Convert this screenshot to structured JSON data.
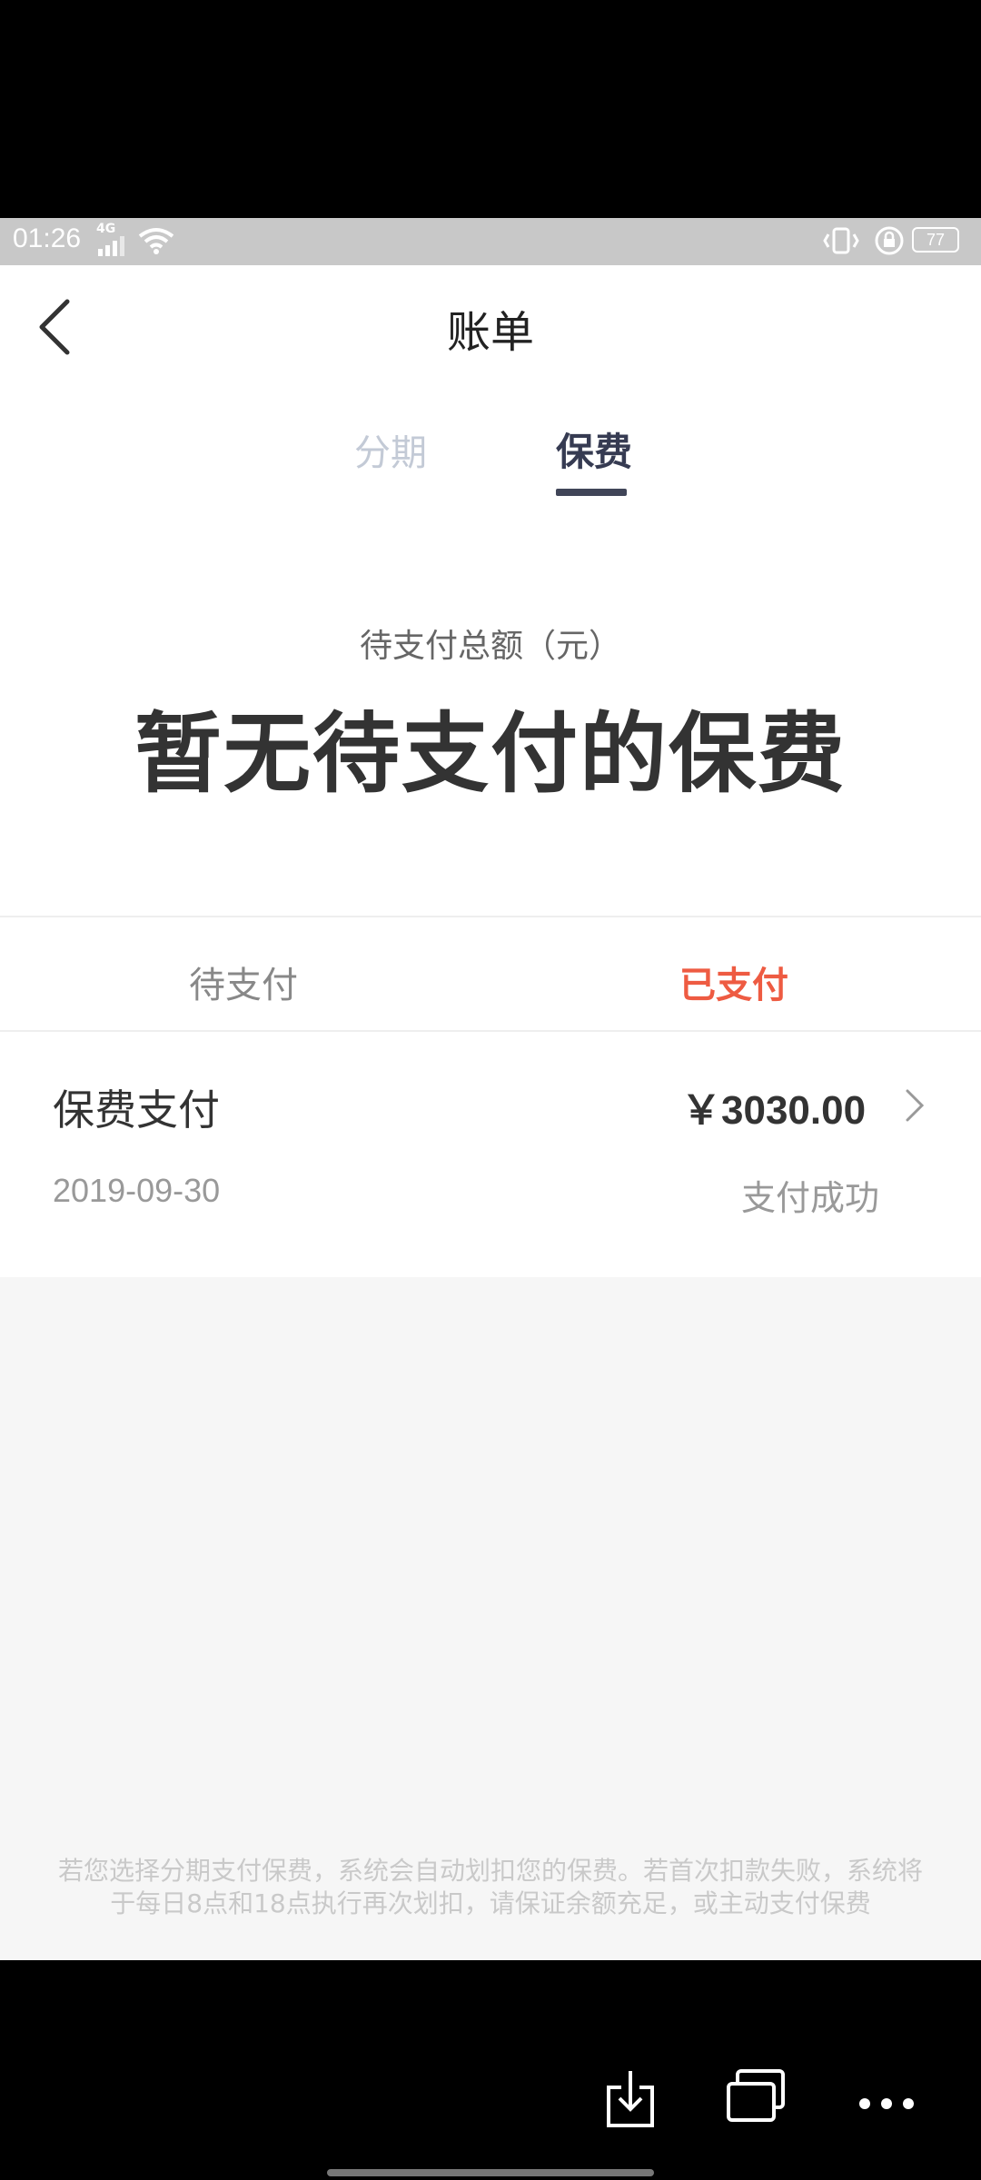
{
  "status_bar": {
    "time": "01:26",
    "network": "4G",
    "battery": "77",
    "icons": [
      "signal-icon",
      "wifi-icon",
      "vibrate-icon",
      "rotation-lock-icon",
      "battery-icon"
    ]
  },
  "header": {
    "title": "账单",
    "back_icon": "chevron-left-icon"
  },
  "tabs": [
    {
      "label": "分期",
      "active": false
    },
    {
      "label": "保费",
      "active": true
    }
  ],
  "summary": {
    "label": "待支付总额（元）",
    "message": "暂无待支付的保费"
  },
  "sub_tabs": [
    {
      "label": "待支付",
      "active": false
    },
    {
      "label": "已支付",
      "active": true
    }
  ],
  "records": [
    {
      "title": "保费支付",
      "amount": "￥3030.00",
      "date": "2019-09-30",
      "status": "支付成功"
    }
  ],
  "footnote": "若您选择分期支付保费，系统会自动划扣您的保费。若首次扣款失败，系统将于每日8点和18点执行再次划扣，请保证余额充足，或主动支付保费",
  "colors": {
    "accent_red": "#ee5b42",
    "tab_active": "#363b52",
    "tab_inactive": "#c3cad6"
  },
  "bottom_bar_icons": [
    "download-icon",
    "window-icon",
    "more-icon"
  ]
}
